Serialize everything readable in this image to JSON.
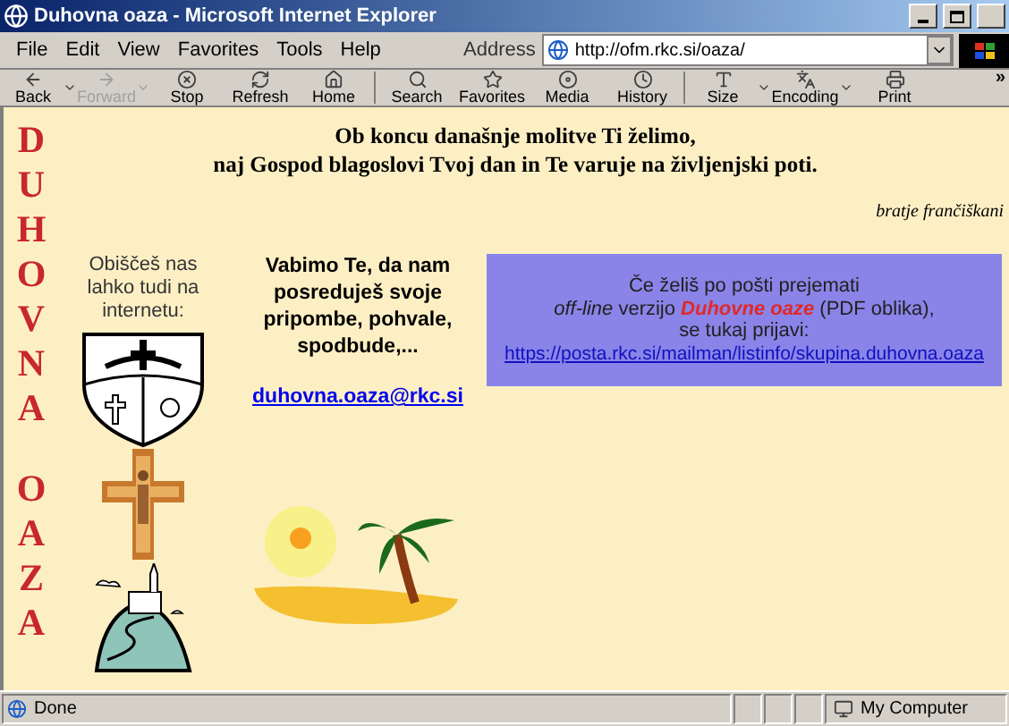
{
  "window": {
    "title": "Duhovna oaza - Microsoft Internet Explorer"
  },
  "menu": [
    "File",
    "Edit",
    "View",
    "Favorites",
    "Tools",
    "Help"
  ],
  "address": {
    "label": "Address",
    "value": "http://ofm.rkc.si/oaza/"
  },
  "toolbar": [
    {
      "label": "Back",
      "disabled": false,
      "dropdown": true
    },
    {
      "label": "Forward",
      "disabled": true,
      "dropdown": true
    },
    {
      "label": "Stop",
      "disabled": false,
      "dropdown": false
    },
    {
      "label": "Refresh",
      "disabled": false,
      "dropdown": false
    },
    {
      "label": "Home",
      "disabled": false,
      "dropdown": false
    },
    {
      "label": "Search",
      "disabled": false,
      "dropdown": false
    },
    {
      "label": "Favorites",
      "disabled": false,
      "dropdown": false
    },
    {
      "label": "Media",
      "disabled": false,
      "dropdown": false
    },
    {
      "label": "History",
      "disabled": false,
      "dropdown": false
    },
    {
      "label": "Size",
      "disabled": false,
      "dropdown": true
    },
    {
      "label": "Encoding",
      "disabled": false,
      "dropdown": true
    },
    {
      "label": "Print",
      "disabled": false,
      "dropdown": false
    }
  ],
  "toolbar_more": "»",
  "page": {
    "side_title": [
      "DUHOVNA",
      "OAZA"
    ],
    "header": [
      "Ob koncu današnje molitve Ti želimo,",
      "naj Gospod blagoslovi Tvoj dan in Te varuje na življenjski poti."
    ],
    "signature": "bratje frančiškani",
    "visit_text": "Obiščeš nas lahko tudi na internetu:",
    "invite_text": "Vabimo Te, da nam posreduješ svoje pripombe, pohvale, spodbude,...",
    "email": "duhovna.oaza@rkc.si",
    "notice": {
      "lines": [
        "Če želiš po pošti prejemati",
        "*off-line* verzijo **Duhovne oaze** (PDF oblika),",
        "se tukaj prijavi:"
      ],
      "link": "https://posta.rkc.si/mailman/listinfo/skupina.duhovna.oaza"
    }
  },
  "status_bar": {
    "text": "Done",
    "zone": "My Computer"
  }
}
